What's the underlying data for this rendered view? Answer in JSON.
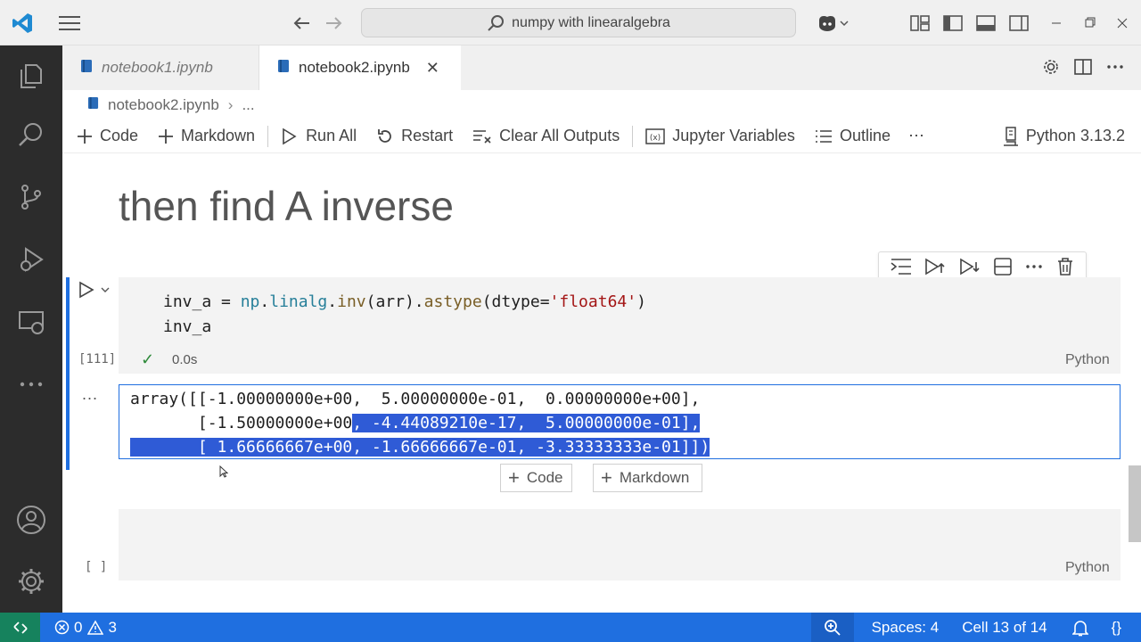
{
  "titlebar": {
    "search_text": "numpy with linearalgebra"
  },
  "tabs": [
    {
      "label": "notebook1.ipynb",
      "active": false
    },
    {
      "label": "notebook2.ipynb",
      "active": true
    }
  ],
  "breadcrumb": {
    "file": "notebook2.ipynb",
    "more": "..."
  },
  "toolbar": {
    "code": "Code",
    "markdown": "Markdown",
    "run_all": "Run All",
    "restart": "Restart",
    "clear_outputs": "Clear All Outputs",
    "variables": "Jupyter Variables",
    "outline": "Outline",
    "more": "⋯",
    "kernel": "Python 3.13.2"
  },
  "markdown_heading": "then find A inverse",
  "code_cell": {
    "line1_parts": [
      {
        "t": "inv_a",
        "c": "#1f1f1f"
      },
      {
        "t": " = ",
        "c": "#1f1f1f"
      },
      {
        "t": "np",
        "c": "#267f99"
      },
      {
        "t": ".",
        "c": "#1f1f1f"
      },
      {
        "t": "linalg",
        "c": "#267f99"
      },
      {
        "t": ".",
        "c": "#1f1f1f"
      },
      {
        "t": "inv",
        "c": "#795e26"
      },
      {
        "t": "(arr).",
        "c": "#1f1f1f"
      },
      {
        "t": "astype",
        "c": "#795e26"
      },
      {
        "t": "(dtype=",
        "c": "#1f1f1f"
      },
      {
        "t": "'float64'",
        "c": "#a31515"
      },
      {
        "t": ")",
        "c": "#1f1f1f"
      }
    ],
    "line2": "inv_a",
    "execution_count": "[111]",
    "exec_time": "0.0s",
    "language": "Python"
  },
  "output": {
    "more": "...",
    "line1": "array([[-1.00000000e+00,  5.00000000e-01,  0.00000000e+00],",
    "line2_plain": "       [-1.50000000e+00",
    "line2_selected": ", -4.44089210e-17,  5.00000000e-01],",
    "line3_selected": "       [ 1.66666667e+00, -1.66666667e-01, -3.33333333e-01]])"
  },
  "insert": {
    "code": "Code",
    "markdown": "Markdown"
  },
  "empty_cell": {
    "execution_count": "[ ]",
    "language": "Python"
  },
  "statusbar": {
    "errors": "0",
    "warnings": "3",
    "spaces": "Spaces: 4",
    "cell": "Cell 13 of 14",
    "braces": "{}"
  },
  "colors": {
    "accent": "#1f6fe0",
    "remote": "#16825d",
    "activitybar": "#2c2c2c",
    "selection": "#2f5bd6"
  }
}
